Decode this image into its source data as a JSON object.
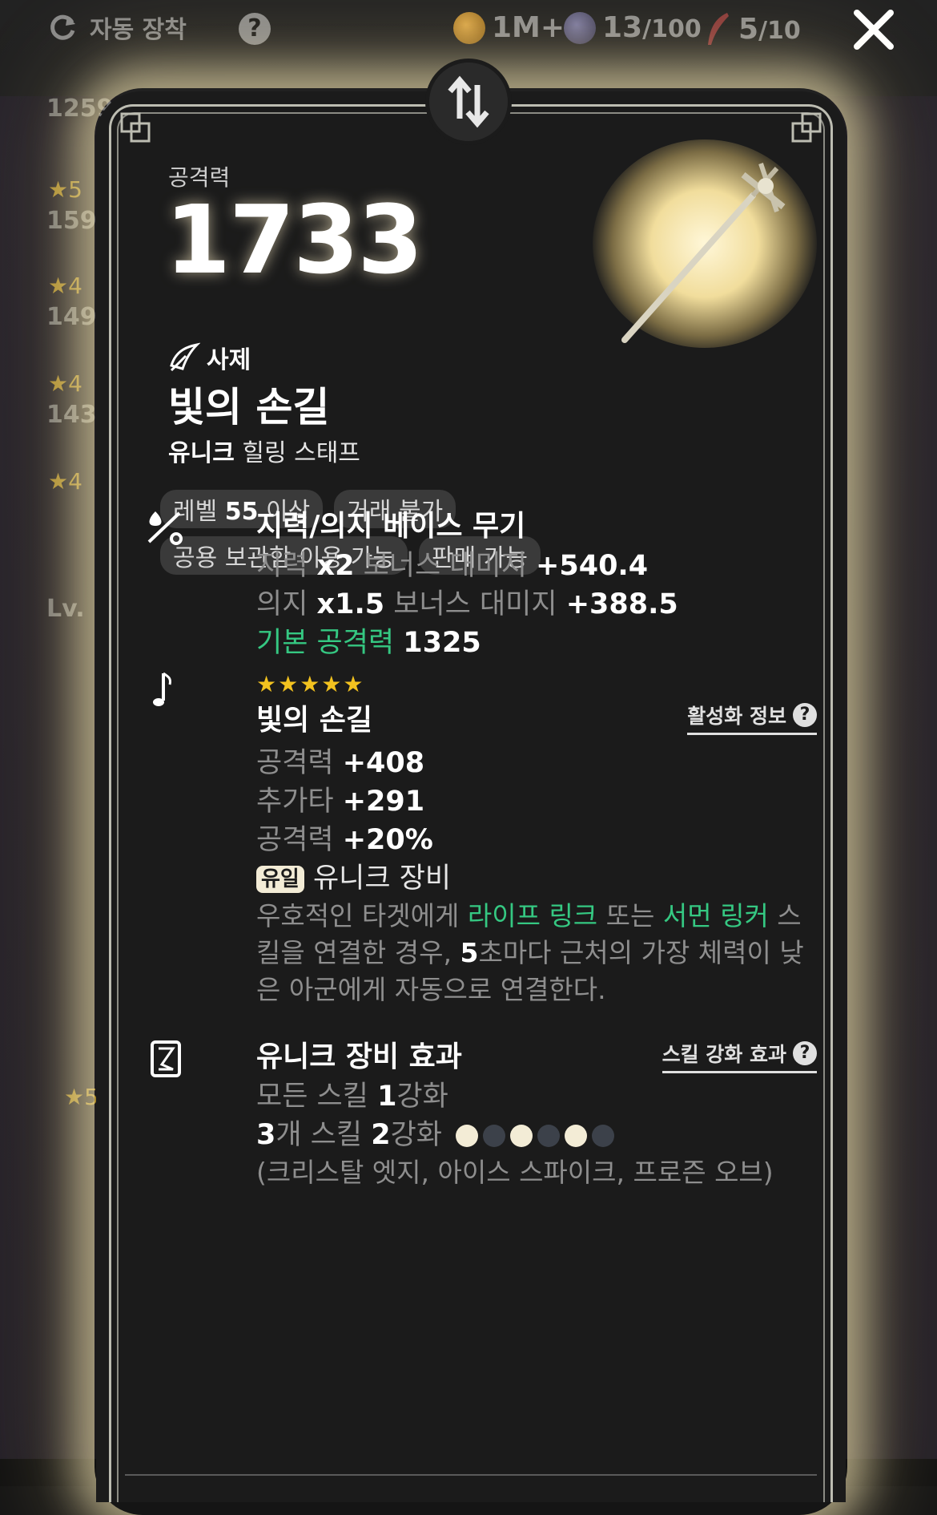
{
  "topbar": {
    "auto_equip_label": "자동 장착",
    "help_glyph": "?",
    "gold": "1M+",
    "orb_current": "13",
    "orb_max": "/100",
    "key_current": "5",
    "key_max": "/10"
  },
  "background": {
    "numbers": [
      "1259",
      "159",
      "149",
      "143",
      "Lv."
    ],
    "stars": [
      "★5",
      "★4",
      "★4",
      "★4",
      "★5"
    ]
  },
  "item": {
    "atk_label": "공격력",
    "atk_value": "1733",
    "class_name": "사제",
    "name": "빛의 손길",
    "grade": "유니크",
    "type": "힐링 스태프",
    "tags_row1": [
      {
        "pre": "레벨 ",
        "bold": "55",
        "post": " 이상"
      },
      {
        "pre": "거래 불가",
        "bold": "",
        "post": ""
      }
    ],
    "tags_row2": [
      {
        "pre": "공용 보관함 이용 가능",
        "bold": "",
        "post": ""
      },
      {
        "pre": "판매 가능",
        "bold": "",
        "post": ""
      }
    ]
  },
  "base_section": {
    "title": "지력/의지 베이스 무기",
    "line1": {
      "label": "지력 ",
      "mult": "x2",
      "mid": " 보너스 대미지 ",
      "value": "+540.4"
    },
    "line2": {
      "label": "의지 ",
      "mult": "x1.5",
      "mid": " 보너스 대미지 ",
      "value": "+388.5"
    },
    "line3": {
      "label": "기본 공격력 ",
      "value": "1325"
    }
  },
  "set_section": {
    "stars": "★★★★★",
    "title": "빛의 손길",
    "link_label": "활성화 정보",
    "stats": [
      {
        "label": "공격력 ",
        "value": "+408"
      },
      {
        "label": "추가타 ",
        "value": "+291"
      },
      {
        "label": "공격력 ",
        "value": "+20%"
      }
    ],
    "unique_badge": "유일",
    "unique_text": "유니크 장비",
    "desc": {
      "p1": "우호적인 타겟에게 ",
      "g1": "라이프 링크",
      "p2": " 또는 ",
      "g2": "서먼 링커",
      "p3": " 스킬을 연결한 경우, ",
      "b1": "5",
      "p4": "초마다 근처의 가장 체력이 낮은 아군에게 자동으로 연결한다."
    }
  },
  "unique_section": {
    "title": "유니크 장비 효과",
    "link_label": "스킬 강화 효과",
    "line1": {
      "pre": "모든 스킬 ",
      "bold": "1",
      "post": "강화"
    },
    "line2": {
      "bold1": "3",
      "mid": "개 스킬 ",
      "bold2": "2",
      "post": "강화"
    },
    "dots": [
      true,
      false,
      true,
      false,
      true,
      false
    ],
    "skills": "(크리스탈 엣지, 아이스 스파이크, 프로즌 오브)"
  },
  "colors": {
    "accent_green": "#35c882",
    "star_gold": "#f2c21f",
    "glow": "#fff0be"
  }
}
